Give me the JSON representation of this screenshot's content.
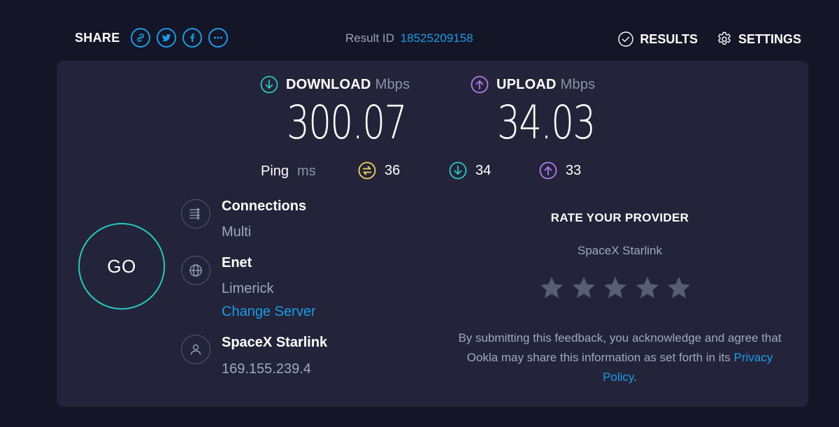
{
  "header": {
    "share_label": "SHARE",
    "share_buttons": [
      {
        "icon": "link-icon"
      },
      {
        "icon": "twitter-icon"
      },
      {
        "icon": "facebook-icon"
      },
      {
        "icon": "more-icon"
      }
    ],
    "result_id_label": "Result ID",
    "result_id_value": "18525209158",
    "results_label": "RESULTS",
    "settings_label": "SETTINGS"
  },
  "download": {
    "label": "DOWNLOAD",
    "unit": "Mbps",
    "value": "300.07",
    "icon": "download-arrow-icon",
    "color": "#2ac7c0"
  },
  "upload": {
    "label": "UPLOAD",
    "unit": "Mbps",
    "value": "34.03",
    "icon": "upload-arrow-icon",
    "color": "#b27bf0"
  },
  "ping": {
    "label": "Ping",
    "unit": "ms",
    "idle": "36",
    "download": "34",
    "upload": "33",
    "idle_color": "#f2d55b",
    "download_color": "#2ac7c0",
    "upload_color": "#b27bf0"
  },
  "go_label": "GO",
  "connections": {
    "title": "Connections",
    "value": "Multi",
    "icon": "connections-icon"
  },
  "server": {
    "name": "Enet",
    "location": "Limerick",
    "change_label": "Change Server",
    "icon": "globe-icon"
  },
  "provider": {
    "name": "SpaceX Starlink",
    "ip": "169.155.239.4",
    "icon": "user-icon"
  },
  "rating": {
    "title": "RATE YOUR PROVIDER",
    "provider": "SpaceX Starlink",
    "stars": 5,
    "selected": 0,
    "disclaimer_text": "By submitting this feedback, you acknowledge and agree that Ookla may share this information as set forth in its",
    "privacy_label": "Privacy Policy",
    "period": "."
  },
  "colors": {
    "background": "#141526",
    "panel": "#232439",
    "accent_blue": "#1c9be8",
    "go_ring": "#2ac7c0",
    "star": "#5a5c70"
  }
}
